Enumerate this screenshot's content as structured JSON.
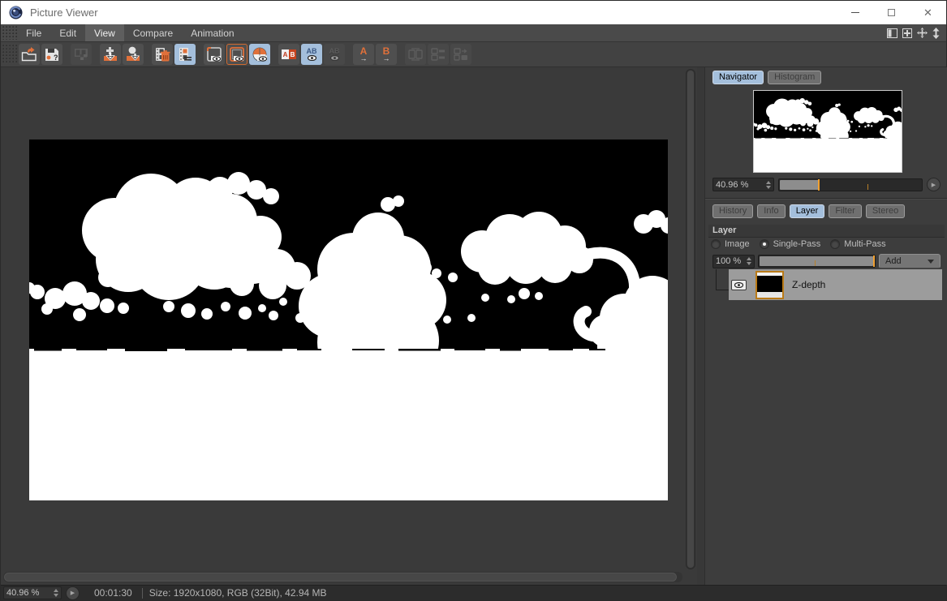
{
  "window": {
    "title": "Picture Viewer",
    "controls": [
      "minimize",
      "maximize",
      "close"
    ]
  },
  "menu": {
    "items": [
      "File",
      "Edit",
      "View",
      "Compare",
      "Animation"
    ],
    "active_item": "View",
    "right_icons": [
      "split-panel-icon",
      "detach-panel-icon",
      "move-panel-icon",
      "scale-panel-icon"
    ]
  },
  "toolbar": {
    "glyphs": {
      "a": "A",
      "b": "B",
      "ab": "AB",
      "question_mark": "?",
      "arrow": "→"
    },
    "groups": [
      {
        "buttons": [
          {
            "name": "open-image",
            "state": "normal"
          },
          {
            "name": "save-image",
            "state": "normal"
          }
        ]
      },
      {
        "buttons": [
          {
            "name": "render-frames",
            "state": "disabled"
          }
        ]
      },
      {
        "buttons": [
          {
            "name": "stack-download",
            "state": "normal"
          },
          {
            "name": "object-download",
            "state": "normal"
          }
        ]
      },
      {
        "buttons": [
          {
            "name": "delete-frames",
            "state": "normal"
          },
          {
            "name": "frame-list",
            "state": "active"
          }
        ]
      },
      {
        "buttons": [
          {
            "name": "show-image-frame",
            "state": "normal"
          },
          {
            "name": "show-filled-frame",
            "state": "framed"
          },
          {
            "name": "show-channels-ball",
            "state": "active"
          }
        ]
      },
      {
        "buttons": [
          {
            "name": "compare-ab",
            "state": "normal"
          },
          {
            "name": "compare-ab-wipe",
            "state": "active"
          },
          {
            "name": "compare-ab-overlay",
            "state": "disabled"
          }
        ]
      },
      {
        "buttons": [
          {
            "name": "set-compare-a",
            "state": "normal"
          },
          {
            "name": "set-compare-b",
            "state": "normal"
          }
        ]
      },
      {
        "buttons": [
          {
            "name": "swap-ab",
            "state": "disabled"
          },
          {
            "name": "align-ab",
            "state": "disabled"
          },
          {
            "name": "ratio-ab",
            "state": "disabled"
          }
        ]
      }
    ]
  },
  "navigator": {
    "tabs": [
      "Navigator",
      "Histogram"
    ],
    "active_tab": "Navigator",
    "zoom": {
      "value": "40.96 %"
    }
  },
  "inspector": {
    "tabs": [
      "History",
      "Info",
      "Layer",
      "Filter",
      "Stereo"
    ],
    "active_tab": "Layer",
    "layer_panel": {
      "header": "Layer",
      "modes": [
        {
          "label": "Image",
          "selected": false
        },
        {
          "label": "Single-Pass",
          "selected": true
        },
        {
          "label": "Multi-Pass",
          "selected": false
        }
      ],
      "opacity": "100 %",
      "add_button": "Add",
      "layers": [
        {
          "name": "Z-depth",
          "visible": true
        }
      ]
    }
  },
  "status_bar": {
    "zoom": "40.96 %",
    "time": "00:01:30",
    "info": "Size: 1920x1080, RGB (32Bit), 42.94 MB"
  },
  "colors": {
    "icon_orange": "#e0703a",
    "marker_orange": "#f0a030",
    "active_blue": "#a4bfdc",
    "selection_gray": "#9c9c9c",
    "canvas_black": "#000000",
    "canvas_white": "#ffffff"
  }
}
